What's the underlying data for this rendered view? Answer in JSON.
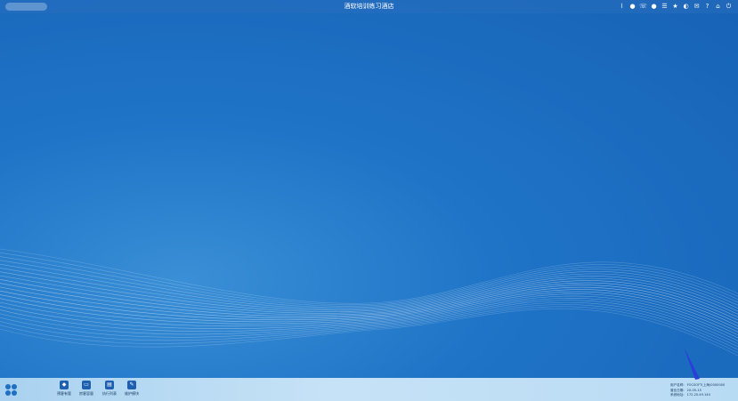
{
  "window": {
    "title": "酒软培训练习酒店"
  },
  "taskbar": {
    "apps": [
      {
        "name": "app-reservation",
        "icon": "hat-icon",
        "glyph": "◆",
        "label": "预客有管"
      },
      {
        "name": "app-room",
        "icon": "room-icon",
        "glyph": "▭",
        "label": "房客容量"
      },
      {
        "name": "app-orders",
        "icon": "list-icon",
        "glyph": "▤",
        "label": "执行列表"
      },
      {
        "name": "app-maintenance",
        "icon": "wrench-icon",
        "glyph": "✎",
        "label": "维护模块"
      }
    ]
  },
  "info": {
    "user_label": "用户名称:",
    "user_value": "FOCSOFT(上海)0000000",
    "date_label": "营业日期:",
    "date_value": "20-05-15",
    "ip_label": "系统地址:",
    "ip_value": "172.20.49.140"
  },
  "colors": {
    "desktop": "#1f74c7",
    "taskbar": "#c6e2f6",
    "accent": "#1f5fb0"
  }
}
